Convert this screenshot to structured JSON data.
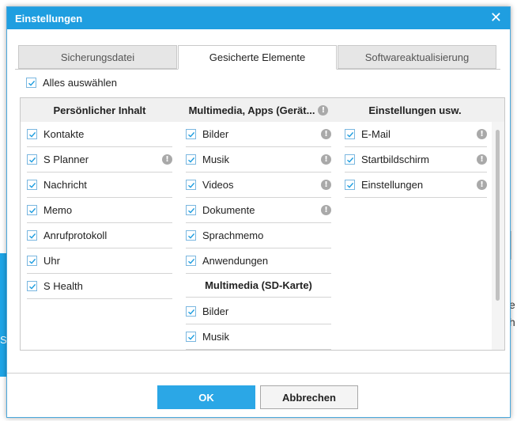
{
  "dialog": {
    "title": "Einstellungen",
    "close_symbol": "✕"
  },
  "tabs": [
    {
      "label": "Sicherungsdatei",
      "active": false
    },
    {
      "label": "Gesicherte Elemente",
      "active": true
    },
    {
      "label": "Softwareaktualisierung",
      "active": false
    }
  ],
  "select_all": {
    "label": "Alles auswählen",
    "checked": true
  },
  "columns": [
    {
      "header": "Persönlicher Inhalt",
      "items": [
        {
          "label": "Kontakte",
          "checked": true,
          "info": false
        },
        {
          "label": "S Planner",
          "checked": true,
          "info": true
        },
        {
          "label": "Nachricht",
          "checked": true,
          "info": false
        },
        {
          "label": "Memo",
          "checked": true,
          "info": false
        },
        {
          "label": "Anrufprotokoll",
          "checked": true,
          "info": false
        },
        {
          "label": "Uhr",
          "checked": true,
          "info": false
        },
        {
          "label": "S Health",
          "checked": true,
          "info": false
        }
      ]
    },
    {
      "header": "Multimedia, Apps (Gerät...",
      "header_info": true,
      "items": [
        {
          "label": "Bilder",
          "checked": true,
          "info": true
        },
        {
          "label": "Musik",
          "checked": true,
          "info": true
        },
        {
          "label": "Videos",
          "checked": true,
          "info": true
        },
        {
          "label": "Dokumente",
          "checked": true,
          "info": true
        },
        {
          "label": "Sprachmemo",
          "checked": true,
          "info": false
        },
        {
          "label": "Anwendungen",
          "checked": true,
          "info": false
        }
      ],
      "subsection": {
        "header": "Multimedia (SD-Karte)",
        "items": [
          {
            "label": "Bilder",
            "checked": true,
            "info": false
          },
          {
            "label": "Musik",
            "checked": true,
            "info": false
          }
        ]
      }
    },
    {
      "header": "Einstellungen usw.",
      "items": [
        {
          "label": "E-Mail",
          "checked": true,
          "info": true
        },
        {
          "label": "Startbildschirm",
          "checked": true,
          "info": true
        },
        {
          "label": "Einstellungen",
          "checked": true,
          "info": true
        }
      ]
    }
  ],
  "info_symbol": "!",
  "buttons": {
    "ok": "OK",
    "cancel": "Abbrechen"
  },
  "colors": {
    "accent": "#1f9ee0",
    "ok_button": "#2ba7e6",
    "check": "#1f9ee0"
  },
  "background": {
    "left_fragment": "Si",
    "right_fragment_1": "e",
    "right_fragment_2": "h"
  }
}
